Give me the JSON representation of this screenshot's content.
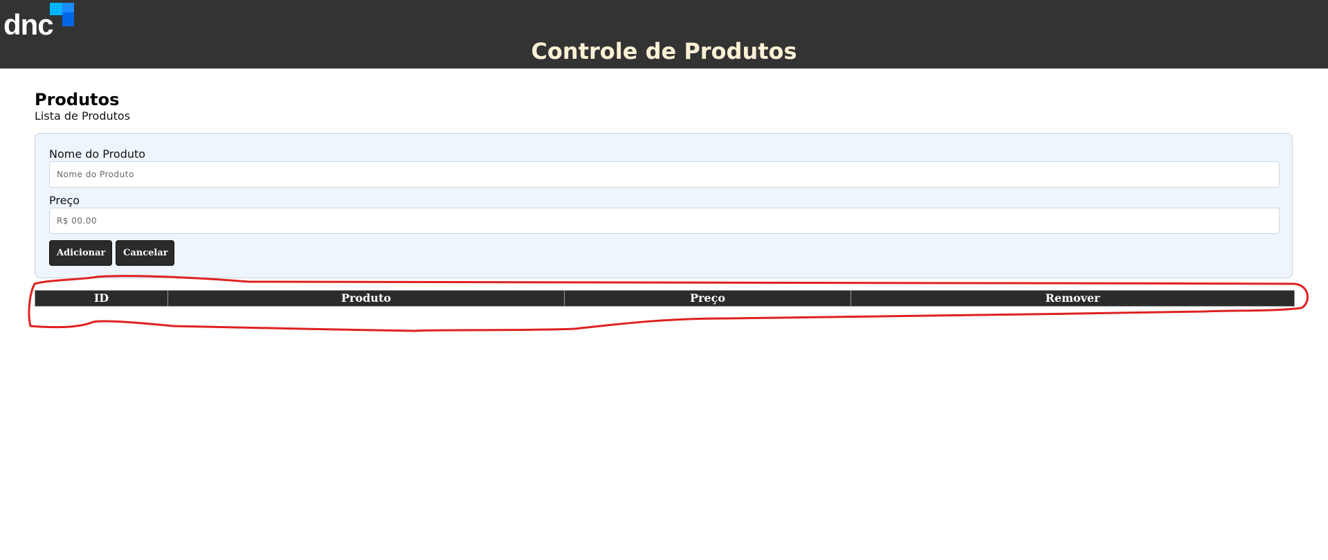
{
  "header": {
    "logo_text": "dnc",
    "title": "Controle de Produtos",
    "background_color": "#333333",
    "title_color": "#fdf1d6"
  },
  "section": {
    "title": "Produtos",
    "subtitle": "Lista de Produtos"
  },
  "form": {
    "name_label": "Nome do Produto",
    "name_placeholder": "Nome do Produto",
    "name_value": "",
    "price_label": "Preço",
    "price_placeholder": "R$ 00.00",
    "price_value": "",
    "add_button": "Adicionar",
    "cancel_button": "Cancelar",
    "background_color": "#eef5fd"
  },
  "table": {
    "columns": [
      "ID",
      "Produto",
      "Preço",
      "Remover"
    ],
    "rows": []
  },
  "annotation": {
    "color": "#e02020",
    "shape": "hand-drawn loop around table"
  }
}
